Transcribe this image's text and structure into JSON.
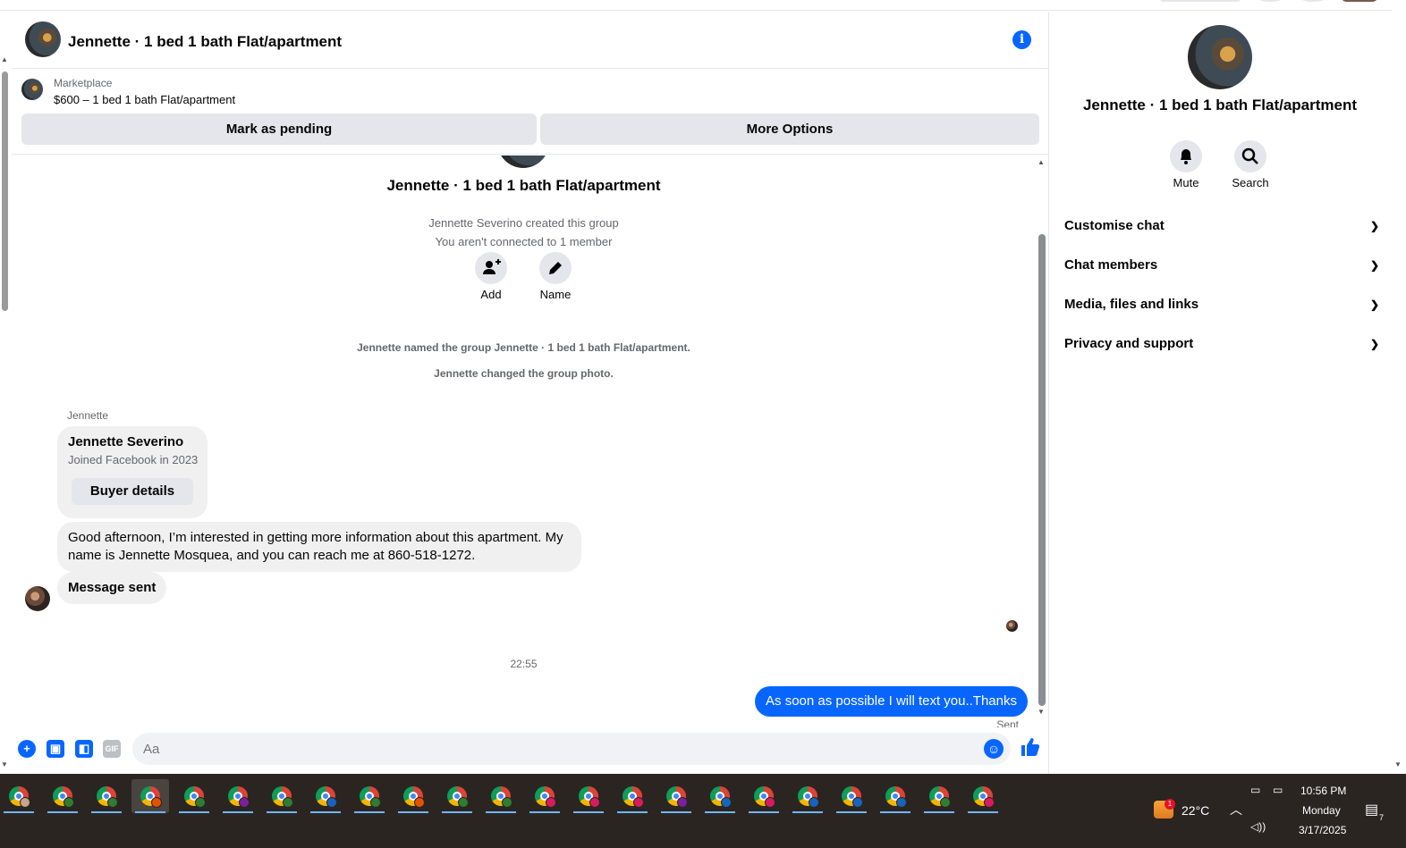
{
  "chat": {
    "title": "Jennette · 1 bed 1 bath Flat/apartment",
    "info_icon": "i"
  },
  "marketplace": {
    "label": "Marketplace",
    "item": "$600 – 1 bed 1 bath Flat/apartment",
    "mark_pending": "Mark as pending",
    "more_options": "More Options"
  },
  "conversation": {
    "group_name": "Jennette · 1 bed 1 bath Flat/apartment",
    "created": "Jennette Severino created this group",
    "not_connected": "You aren't connected to 1 member",
    "add_label": "Add",
    "name_label": "Name",
    "sys1": "Jennette named the group Jennette · 1 bed 1 bath Flat/apartment.",
    "sys2": "Jennette changed the group photo.",
    "sender": "Jennette",
    "card_name": "Jennette Severino",
    "card_sub": "Joined Facebook in 2023",
    "buyer_details": "Buyer details",
    "msg1": "Good afternoon, I’m interested in getting more information about this apartment. My name is Jennette Mosquea, and you can reach me at 860-518-1272.",
    "msg2": "Message sent",
    "timestamp": "22:55",
    "out_msg": "As soon as possible I will text you..Thanks",
    "sent": "Sent"
  },
  "composer": {
    "placeholder": "Aa",
    "gif": "GIF"
  },
  "sidebar": {
    "title": "Jennette · 1 bed 1 bath Flat/apartment",
    "mute": "Mute",
    "search": "Search",
    "sections": [
      "Customise chat",
      "Chat members",
      "Media, files and links",
      "Privacy and support"
    ]
  },
  "taskbar": {
    "temperature": "22°C",
    "weather_badge": "1",
    "time": "10:56 PM",
    "day": "Monday",
    "date": "3/17/2025",
    "notification_count": "7"
  },
  "colors": {
    "accent": "#0866ff",
    "taskbar_bg": "#2b2522",
    "bubble_in": "#f0f0f0"
  }
}
